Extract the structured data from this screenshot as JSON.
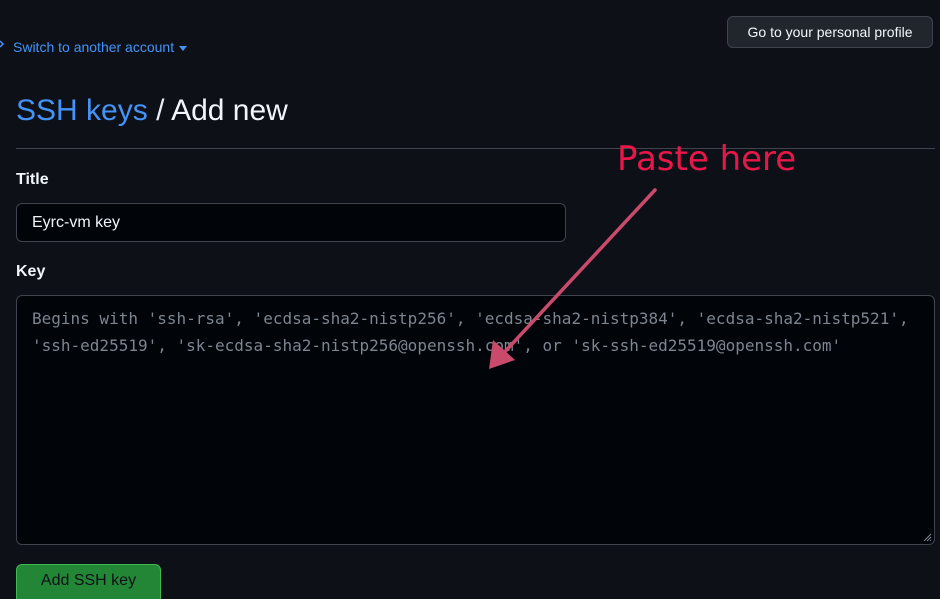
{
  "header": {
    "switch_account_label": "Switch to another account",
    "profile_button_label": "Go to your personal profile"
  },
  "breadcrumb": {
    "parent": "SSH keys",
    "separator": "/",
    "current": "Add new"
  },
  "form": {
    "title_label": "Title",
    "title_value": "Eyrc-vm key",
    "key_label": "Key",
    "key_placeholder": "Begins with 'ssh-rsa', 'ecdsa-sha2-nistp256', 'ecdsa-sha2-nistp384', 'ecdsa-sha2-nistp521', 'ssh-ed25519', 'sk-ecdsa-sha2-nistp256@openssh.com', or 'sk-ssh-ed25519@openssh.com'",
    "submit_label": "Add SSH key"
  },
  "annotation": {
    "text": "Paste here",
    "color": "#e8174a",
    "arrow_color": "#c94a6a"
  },
  "colors": {
    "background": "#0d1117",
    "link": "#4493f8",
    "primary_button": "#238636",
    "border": "#3d444d"
  },
  "icons": {
    "switch_caret": "chevron-down-icon",
    "textarea_resize": "resize-grip-icon",
    "annotation_arrow": "arrow-icon"
  }
}
